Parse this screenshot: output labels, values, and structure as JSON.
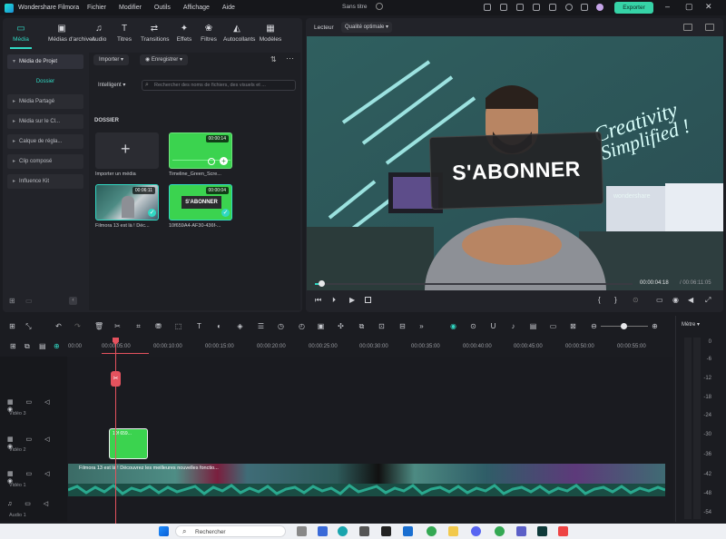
{
  "titlebar": {
    "app_name": "Wondershare Filmora",
    "menu": [
      "Fichier",
      "Modifier",
      "Outils",
      "Affichage",
      "Aide"
    ],
    "doc_title": "Sans titre",
    "export_label": "Exporter"
  },
  "left_panel": {
    "tabs": [
      {
        "label": "Média",
        "icon": "folder-icon"
      },
      {
        "label": "Médias d'archives",
        "icon": "archive-icon"
      },
      {
        "label": "Audio",
        "icon": "music-icon"
      },
      {
        "label": "Titres",
        "icon": "text-icon"
      },
      {
        "label": "Transitions",
        "icon": "transition-icon"
      },
      {
        "label": "Effets",
        "icon": "sparkle-icon"
      },
      {
        "label": "Filtres",
        "icon": "filter-icon"
      },
      {
        "label": "Autocollants",
        "icon": "sticker-icon"
      },
      {
        "label": "Modèles",
        "icon": "template-icon"
      }
    ],
    "sidebar": [
      {
        "label": "Média de Projet"
      },
      {
        "label": "Dossier"
      },
      {
        "label": "Média Partagé"
      },
      {
        "label": "Média sur le Cl..."
      },
      {
        "label": "Calque de régla..."
      },
      {
        "label": "Clip composé"
      },
      {
        "label": "Influence Kit"
      }
    ],
    "import_label": "Importer",
    "record_label": "Enregistrer",
    "sort_label": "Intelligent",
    "search_placeholder": "Rechercher des noms de fichiers, des visuels et ...",
    "folder_heading": "DOSSIER",
    "media": [
      {
        "label": "Importer un média"
      },
      {
        "label": "Timeline_Green_Scre...",
        "duration": "00:00:14"
      },
      {
        "label": "Filmora 13 est là ! Déc...",
        "duration": "00:06:11"
      },
      {
        "label": "10f659A4-AF30-436f-...",
        "duration": "00:00:04",
        "overlay": "S'ABONNER"
      }
    ]
  },
  "player": {
    "label": "Lecteur",
    "quality": "Qualité optimale",
    "overlay_text": "S'ABONNER",
    "neon_text_1": "Creativity",
    "neon_text_2": "Simplified !",
    "brand_text": "wondershare",
    "current_time": "00:00:04:18",
    "total_time": "/ 00:06:11:05"
  },
  "timeline": {
    "ticks": [
      "00:00",
      "00:00:05:00",
      "00:00:10:00",
      "00:00:15:00",
      "00:00:20:00",
      "00:00:25:00",
      "00:00:30:00",
      "00:00:35:00",
      "00:00:40:00",
      "00:00:45:00",
      "00:00:50:00",
      "00:00:55:00"
    ],
    "tracks": [
      {
        "name": "Vidéo 3",
        "num": "3"
      },
      {
        "name": "Vidéo 2",
        "num": "2"
      },
      {
        "name": "Vidéo 1",
        "num": "1"
      },
      {
        "name": "Audio 1",
        "num": "1"
      }
    ],
    "clip_label": "10f 659...",
    "main_clip_label": "Filmora 13 est là ! Découvrez les meilleures nouvelles fonctio...",
    "meter_label": "Mètre",
    "meter_ticks": [
      "0",
      "-6",
      "-12",
      "-18",
      "-24",
      "-30",
      "-36",
      "-42",
      "-48",
      "-54"
    ]
  },
  "taskbar": {
    "search_label": "Rechercher"
  },
  "colors": {
    "accent": "#31d8c3",
    "export": "#36d3a7",
    "playhead": "#e4525e",
    "clip_green": "#3bd34f",
    "audio_wave": "#2aa98f"
  }
}
